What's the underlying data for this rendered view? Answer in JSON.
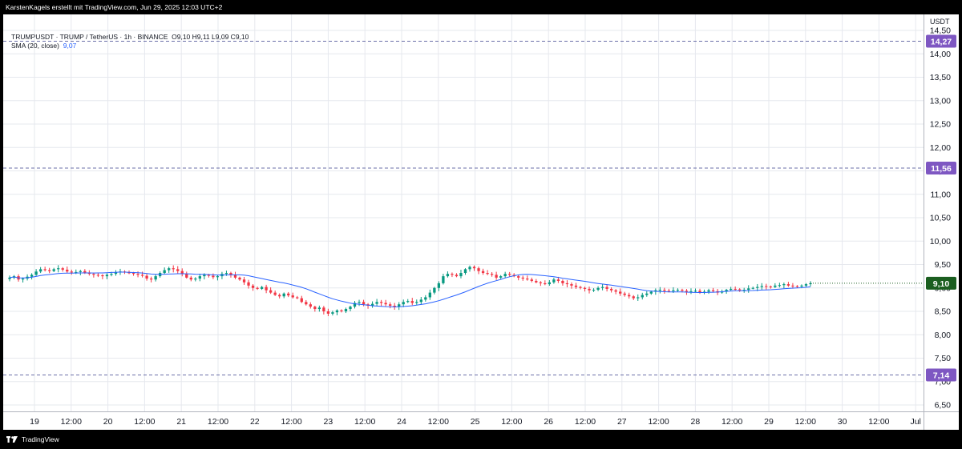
{
  "header": {
    "attribution": "KarstenKagels erstellt mit TradingView.com, Jun 29, 2025 12:03 UTC+2"
  },
  "legend": {
    "symbol_line": "TRUMPUSDT · TRUMP / TetherUS · 1h · BINANCE",
    "ohlc": "O9,10  H9,11  L9,09  C9,10",
    "sma_label": "SMA (20, close)",
    "sma_value": "9,07"
  },
  "footer": {
    "brand": "TradingView"
  },
  "colors": {
    "up": "#089981",
    "down": "#f23645",
    "sma": "#2962ff",
    "level_line": "#6b6fa8",
    "level_tag": "#7e57c2",
    "last_price_tag": "#1b5e20",
    "grid": "#e6e8ee"
  },
  "chart_data": {
    "type": "candlestick",
    "y_axis": {
      "unit_label": "USDT",
      "min": 6.5,
      "max": 14.5,
      "ticks": [
        "6,50",
        "7,00",
        "7,50",
        "8,00",
        "8,50",
        "9,00",
        "9,50",
        "10,00",
        "10,50",
        "11,00",
        "11,50",
        "12,00",
        "12,50",
        "13,00",
        "13,50",
        "14,00",
        "14,50"
      ],
      "tick_values": [
        6.5,
        7.0,
        7.5,
        8.0,
        8.5,
        9.0,
        9.5,
        10.0,
        10.5,
        11.0,
        11.5,
        12.0,
        12.5,
        13.0,
        13.5,
        14.0,
        14.5
      ]
    },
    "x_axis": {
      "labels": [
        "19",
        "12:00",
        "20",
        "12:00",
        "21",
        "12:00",
        "22",
        "12:00",
        "23",
        "12:00",
        "24",
        "12:00",
        "25",
        "12:00",
        "26",
        "12:00",
        "27",
        "12:00",
        "28",
        "12:00",
        "29",
        "12:00",
        "30",
        "12:00",
        "Jul"
      ],
      "start": "Jun 18 15:00",
      "end": "Jul 1"
    },
    "horizontal_levels": [
      {
        "label": "14,27",
        "value": 14.27
      },
      {
        "label": "11,56",
        "value": 11.56
      },
      {
        "label": "7,14",
        "value": 7.14
      }
    ],
    "last_price": {
      "label": "9,10",
      "value": 9.1
    },
    "sma": {
      "period": 20,
      "source": "close"
    },
    "closes": [
      9.22,
      9.25,
      9.18,
      9.2,
      9.24,
      9.28,
      9.35,
      9.4,
      9.38,
      9.36,
      9.4,
      9.42,
      9.39,
      9.35,
      9.33,
      9.34,
      9.36,
      9.33,
      9.3,
      9.28,
      9.27,
      9.25,
      9.28,
      9.3,
      9.33,
      9.35,
      9.33,
      9.32,
      9.3,
      9.28,
      9.26,
      9.2,
      9.18,
      9.25,
      9.32,
      9.38,
      9.42,
      9.4,
      9.36,
      9.3,
      9.22,
      9.18,
      9.2,
      9.25,
      9.28,
      9.26,
      9.23,
      9.25,
      9.3,
      9.32,
      9.28,
      9.22,
      9.18,
      9.12,
      9.05,
      9.0,
      8.98,
      9.02,
      8.95,
      8.9,
      8.85,
      8.82,
      8.88,
      8.84,
      8.8,
      8.78,
      8.7,
      8.65,
      8.6,
      8.55,
      8.58,
      8.5,
      8.45,
      8.48,
      8.52,
      8.5,
      8.55,
      8.6,
      8.68,
      8.7,
      8.65,
      8.62,
      8.66,
      8.7,
      8.68,
      8.65,
      8.62,
      8.6,
      8.65,
      8.7,
      8.72,
      8.68,
      8.7,
      8.75,
      8.8,
      8.9,
      9.0,
      9.1,
      9.25,
      9.3,
      9.28,
      9.25,
      9.32,
      9.4,
      9.45,
      9.42,
      9.36,
      9.32,
      9.3,
      9.28,
      9.22,
      9.25,
      9.3,
      9.28,
      9.25,
      9.22,
      9.2,
      9.18,
      9.15,
      9.12,
      9.1,
      9.08,
      9.12,
      9.18,
      9.15,
      9.1,
      9.08,
      9.05,
      9.02,
      9.0,
      8.98,
      8.95,
      8.96,
      9.0,
      9.02,
      8.98,
      8.95,
      8.92,
      8.88,
      8.85,
      8.82,
      8.78,
      8.8,
      8.85,
      8.88,
      8.92,
      8.95,
      8.96,
      8.94,
      8.93,
      8.95,
      8.96,
      8.94,
      8.92,
      8.93,
      8.94,
      8.9,
      8.92,
      8.95,
      8.93,
      8.9,
      8.92,
      8.96,
      8.98,
      8.97,
      8.95,
      8.96,
      8.99,
      9.0,
      9.02,
      9.04,
      9.03,
      9.02,
      9.05,
      9.06,
      9.08,
      9.05,
      9.04,
      9.03,
      9.05,
      9.08,
      9.1
    ]
  }
}
